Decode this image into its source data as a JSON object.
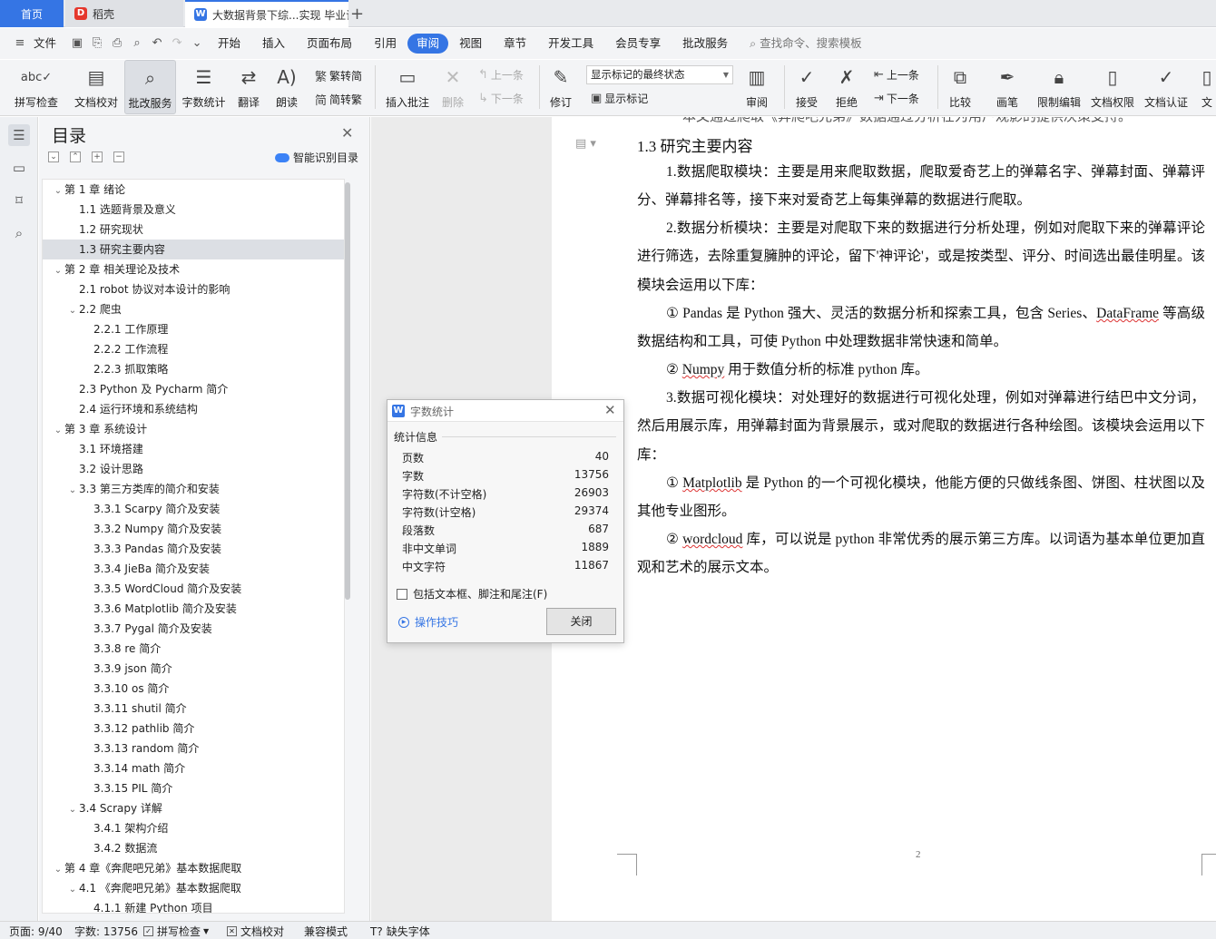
{
  "tabs": {
    "home": "首页",
    "daoke": "稻壳",
    "document": "大数据背景下综...实现 毕业论",
    "add": "+"
  },
  "menu": {
    "file": "文件",
    "items": [
      "开始",
      "插入",
      "页面布局",
      "引用",
      "审阅",
      "视图",
      "章节",
      "开发工具",
      "会员专享",
      "批改服务"
    ],
    "active": "审阅",
    "search": "查找命令、搜索模板"
  },
  "ribbon": {
    "spellcheck": "拼写检查",
    "doc_check": "文档校对",
    "correction_service": "批改服务",
    "word_count": "字数统计",
    "translate": "翻译",
    "read_aloud": "朗读",
    "trad_to_simp": "繁转简",
    "simp_to_trad": "简转繁",
    "insert_comment": "插入批注",
    "delete": "删除",
    "prev": "上一条",
    "next": "下一条",
    "track_changes": "修订",
    "markup_state": "显示标记的最终状态",
    "show_markup": "显示标记",
    "review": "审阅",
    "accept": "接受",
    "reject": "拒绝",
    "prev2": "上一条",
    "next2": "下一条",
    "compare": "比较",
    "pen": "画笔",
    "restrict_edit": "限制编辑",
    "doc_permission": "文档权限",
    "doc_cert": "文档认证",
    "more": "文"
  },
  "toc": {
    "title": "目录",
    "smart": "智能识别目录",
    "items": [
      {
        "label": "第 1 章  绪论",
        "level": 1,
        "arrow": "down"
      },
      {
        "label": "1.1  选题背景及意义",
        "level": 2
      },
      {
        "label": "1.2  研究现状",
        "level": 2
      },
      {
        "label": "1.3  研究主要内容",
        "level": 2,
        "selected": true
      },
      {
        "label": "第 2 章  相关理论及技术",
        "level": 1,
        "arrow": "down"
      },
      {
        "label": "2.1 robot 协议对本设计的影响",
        "level": 2
      },
      {
        "label": "2.2  爬虫",
        "level": 2,
        "arrow": "down"
      },
      {
        "label": "2.2.1  工作原理",
        "level": 3
      },
      {
        "label": "2.2.2  工作流程",
        "level": 3
      },
      {
        "label": "2.2.3  抓取策略",
        "level": 3
      },
      {
        "label": "2.3 Python 及 Pycharm 简介",
        "level": 2
      },
      {
        "label": "2.4 运行环境和系统结构",
        "level": 2
      },
      {
        "label": "第 3 章  系统设计",
        "level": 1,
        "arrow": "down"
      },
      {
        "label": "3.1 环境搭建",
        "level": 2
      },
      {
        "label": "3.2 设计思路",
        "level": 2
      },
      {
        "label": "3.3  第三方类库的简介和安装",
        "level": 2,
        "arrow": "down"
      },
      {
        "label": "3.3.1 Scarpy 简介及安装",
        "level": 3
      },
      {
        "label": "3.3.2 Numpy 简介及安装",
        "level": 3
      },
      {
        "label": "3.3.3 Pandas 简介及安装",
        "level": 3
      },
      {
        "label": "3.3.4 JieBa 简介及安装",
        "level": 3
      },
      {
        "label": "3.3.5 WordCloud 简介及安装",
        "level": 3
      },
      {
        "label": "3.3.6 Matplotlib 简介及安装",
        "level": 3
      },
      {
        "label": "3.3.7 Pygal 简介及安装",
        "level": 3
      },
      {
        "label": "3.3.8 re  简介",
        "level": 3
      },
      {
        "label": "3.3.9 json 简介",
        "level": 3
      },
      {
        "label": "3.3.10 os 简介",
        "level": 3
      },
      {
        "label": "3.3.11 shutil 简介",
        "level": 3
      },
      {
        "label": "3.3.12 pathlib 简介",
        "level": 3
      },
      {
        "label": "3.3.13 random  简介",
        "level": 3
      },
      {
        "label": "3.3.14 math 简介",
        "level": 3
      },
      {
        "label": "3.3.15 PIL 简介",
        "level": 3
      },
      {
        "label": "3.4 Scrapy 详解",
        "level": 2,
        "arrow": "down"
      },
      {
        "label": "3.4.1  架构介绍",
        "level": 3
      },
      {
        "label": "3.4.2  数据流",
        "level": 3
      },
      {
        "label": "第 4 章《奔爬吧兄弟》基本数据爬取",
        "level": 1,
        "arrow": "down"
      },
      {
        "label": "4.1 《奔爬吧兄弟》基本数据爬取",
        "level": 2,
        "arrow": "down"
      },
      {
        "label": "4.1.1  新建 Python 项目",
        "level": 3
      }
    ]
  },
  "document": {
    "top_cut": "本文通过爬取《奔爬吧兄弟》数据通过分析在为用户观影的提供决策支持。",
    "section_title": "1.3  研究主要内容",
    "p1": "1.数据爬取模块：主要是用来爬取数据，爬取爱奇艺上的弹幕名字、弹幕封面、弹幕评分、弹幕排名等，接下来对爱奇艺上每集弹幕的数据进行爬取。",
    "p2": "2.数据分析模块：主要是对爬取下来的数据进行分析处理，例如对爬取下来的弹幕评论进行筛选，去除重复臃肿的评论，留下'神评论'，或是按类型、评分、时间选出最佳明星。该模块会运用以下库：",
    "p3a": "①   Pandas 是 Python 强大、灵活的数据分析和探索工具，包含 Series、",
    "p3b": "DataFrame",
    "p3c": " 等高级数据结构和工具，可使 Python 中处理数据非常快速和简单。",
    "p4a": "②   ",
    "p4b": "Numpy",
    "p4c": " 用于数值分析的标准 python 库。",
    "p5": "3.数据可视化模块：对处理好的数据进行可视化处理，例如对弹幕进行结巴中文分词，然后用展示库，用弹幕封面为背景展示，或对爬取的数据进行各种绘图。该模块会运用以下库：",
    "p6a": "①   ",
    "p6b": "Matplotlib",
    "p6c": " 是 Python 的一个可视化模块，他能方便的只做线条图、饼图、柱状图以及其他专业图形。",
    "p7a": "②   ",
    "p7b": "wordcloud",
    "p7c": " 库，可以说是 python 非常优秀的展示第三方库。以词语为基本单位更加直观和艺术的展示文本。",
    "page_number": "2"
  },
  "dialog": {
    "title": "字数统计",
    "section": "统计信息",
    "stats": [
      {
        "label": "页数",
        "value": "40"
      },
      {
        "label": "字数",
        "value": "13756"
      },
      {
        "label": "字符数(不计空格)",
        "value": "26903"
      },
      {
        "label": "字符数(计空格)",
        "value": "29374"
      },
      {
        "label": "段落数",
        "value": "687"
      },
      {
        "label": "非中文单词",
        "value": "1889"
      },
      {
        "label": "中文字符",
        "value": "11867"
      }
    ],
    "checkbox": "包括文本框、脚注和尾注(F)",
    "tips": "操作技巧",
    "close": "关闭"
  },
  "status": {
    "page": "页面: 9/40",
    "words": "字数: 13756",
    "spell": "拼写检查",
    "doc_check": "文档校对",
    "compat": "兼容模式",
    "missing_font": "缺失字体"
  },
  "colors": {
    "accent": "#3575e4",
    "spell_underline": "#d33"
  }
}
